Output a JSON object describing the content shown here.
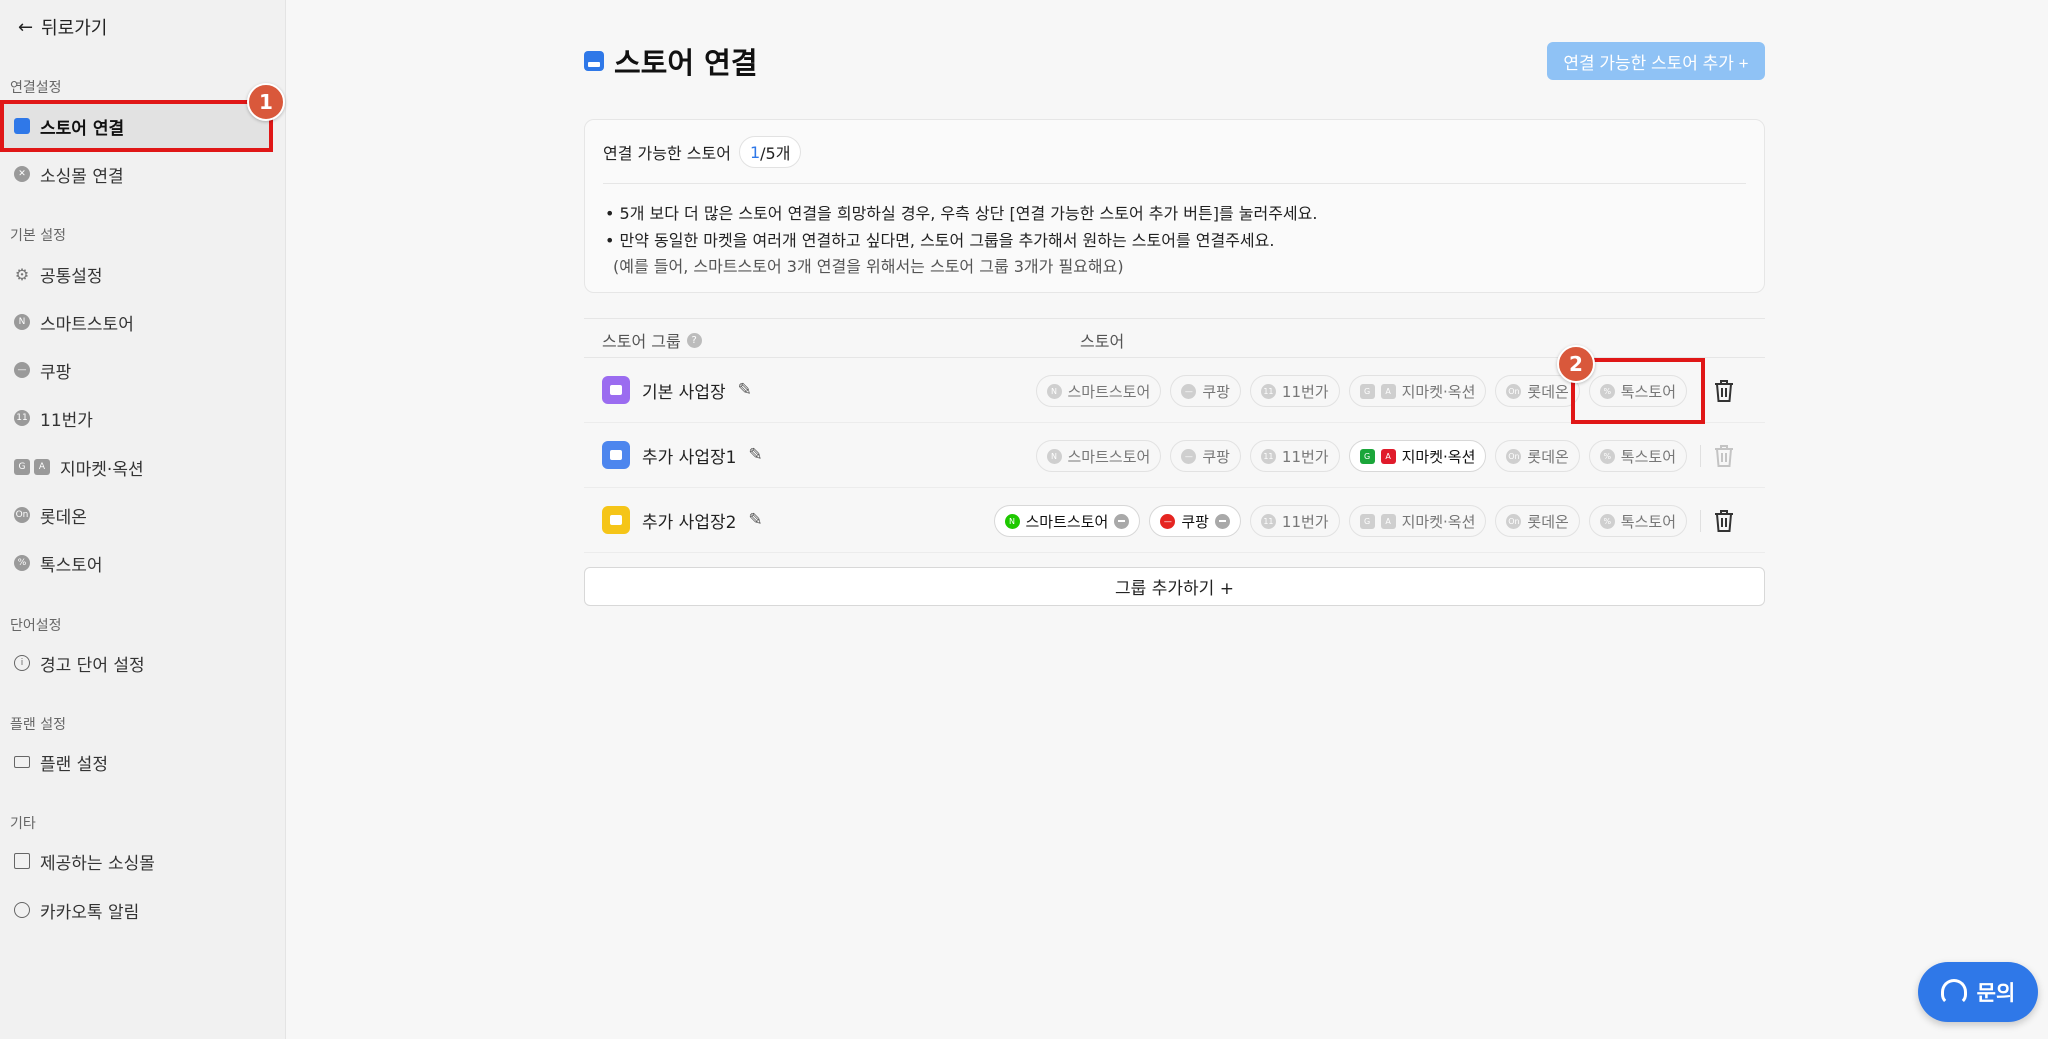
{
  "sidebar": {
    "back_label": "뒤로가기",
    "sections": {
      "connect": "연결설정",
      "basic": "기본 설정",
      "words": "단어설정",
      "plan": "플랜 설정",
      "etc": "기타"
    },
    "items": {
      "store_connect": "스토어 연결",
      "social_connect": "소싱몰 연결",
      "common": "공통설정",
      "smartstore": "스마트스토어",
      "coupang": "쿠팡",
      "eleven": "11번가",
      "gmarket": "지마켓·옥션",
      "lotteon": "롯데온",
      "toss": "톡스토어",
      "warning_words": "경고 단어 설정",
      "plan_settings": "플랜 설정",
      "provided_malls": "제공하는 소싱몰",
      "kakao_alert": "카카오톡 알림"
    }
  },
  "annotations": {
    "badge1": "1",
    "badge2": "2"
  },
  "main": {
    "title": "스토어 연결",
    "add_store_button": "연결 가능한 스토어 추가 +",
    "info": {
      "label": "연결 가능한 스토어",
      "count_current": "1",
      "count_rest": "/5개",
      "line1": "• 5개 보다 더 많은 스토어 연결을 희망하실 경우, 우측 상단 [연결 가능한 스토어 추가 버튼]를 눌러주세요.",
      "line2": "• 만약 동일한 마켓을 여러개 연결하고 싶다면, 스토어 그룹을 추가해서 원하는 스토어를 연결주세요.",
      "line3": "(예를 들어, 스마트스토어 3개 연결을 위해서는 스토어 그룹 3개가 필요해요)"
    },
    "table": {
      "col_group": "스토어 그룹",
      "col_store": "스토어",
      "rows": [
        {
          "name": "기본 사업장",
          "color": "#9b6cf0"
        },
        {
          "name": "추가 사업장1",
          "color": "#4d86ee"
        },
        {
          "name": "추가 사업장2",
          "color": "#f5c518"
        }
      ],
      "chips": {
        "smartstore": "스마트스토어",
        "coupang": "쿠팡",
        "eleven": "11번가",
        "gmarket": "지마켓·옥션",
        "lotteon": "롯데온",
        "toss": "톡스토어"
      }
    },
    "add_group_button": "그룹 추가하기 +",
    "help_button": "문의"
  },
  "colors": {
    "accent": "#2f78e8",
    "highlight": "#e01717",
    "badge": "#d9583b"
  }
}
